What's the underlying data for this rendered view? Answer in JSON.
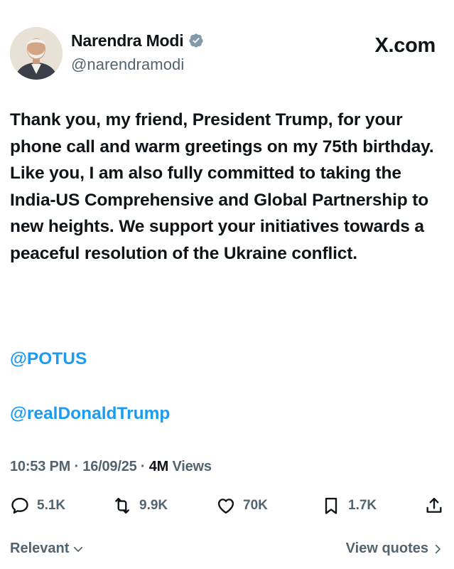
{
  "author": {
    "name": "Narendra Modi",
    "handle": "@narendramodi",
    "verified": true
  },
  "brand": "X.com",
  "tweet": {
    "text": "Thank you, my friend, President Trump, for your phone call and warm greetings on my 75th birthday. Like you, I am also fully committed to taking the India-US Comprehensive and Global Partnership to new heights. We support your initiatives towards a peaceful resolution of the Ukraine conflict.",
    "mentions": [
      "@POTUS",
      "@realDonaldTrump"
    ]
  },
  "meta": {
    "time": "10:53 PM",
    "date": "16/09/25",
    "separator": "·",
    "views_count": "4M",
    "views_label": "Views"
  },
  "actions": {
    "reply": {
      "icon": "reply-icon",
      "count": "5.1K"
    },
    "retweet": {
      "icon": "retweet-icon",
      "count": "9.9K"
    },
    "like": {
      "icon": "heart-icon",
      "count": "70K"
    },
    "bookmark": {
      "icon": "bookmark-icon",
      "count": "1.7K"
    },
    "share": {
      "icon": "share-icon"
    }
  },
  "footer": {
    "sort_label": "Relevant",
    "quotes_label": "View quotes"
  },
  "colors": {
    "text": "#0f1419",
    "secondary": "#536471",
    "accent": "#1d9bf0"
  }
}
